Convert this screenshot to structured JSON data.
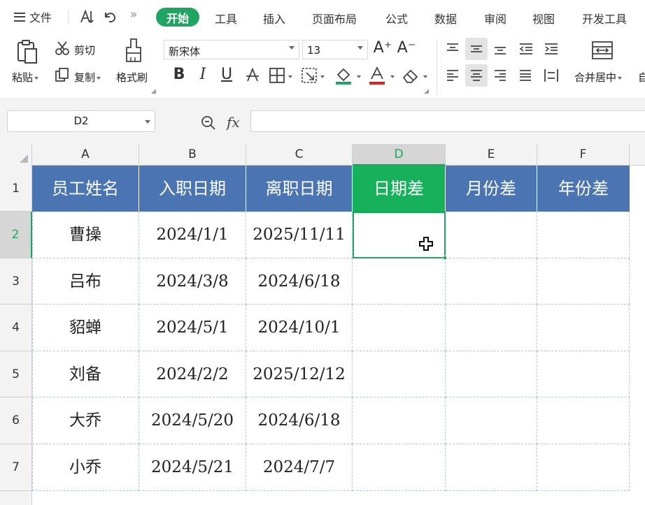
{
  "menubar": {
    "file_label": "文件",
    "tabs": [
      "开始",
      "工具",
      "插入",
      "页面布局",
      "公式",
      "数据",
      "审阅",
      "视图",
      "开发工具"
    ],
    "active_tab": "开始"
  },
  "ribbon": {
    "paste_label": "粘贴",
    "cut_label": "剪切",
    "copy_label": "复制",
    "format_painter_label": "格式刷",
    "font_name": "新宋体",
    "font_size": "13",
    "merge_label": "合并居中",
    "bold": "B",
    "italic": "I",
    "underline": "U",
    "font_grow": "A⁺",
    "font_shrink": "A⁻"
  },
  "formula_bar": {
    "cell_ref": "D2",
    "fx_label": "fx",
    "formula": ""
  },
  "sheet": {
    "columns": [
      "A",
      "B",
      "C",
      "D",
      "E",
      "F"
    ],
    "selected_column": "D",
    "rows": [
      "1",
      "2",
      "3",
      "4",
      "5",
      "6",
      "7"
    ],
    "selected_row": "2",
    "headers": [
      "员工姓名",
      "入职日期",
      "离职日期",
      "日期差",
      "月份差",
      "年份差"
    ],
    "data": [
      [
        "曹操",
        "2024/1/1",
        "2025/11/11",
        "",
        "",
        ""
      ],
      [
        "吕布",
        "2024/3/8",
        "2024/6/18",
        "",
        "",
        ""
      ],
      [
        "貂蝉",
        "2024/5/1",
        "2024/10/1",
        "",
        "",
        ""
      ],
      [
        "刘备",
        "2024/2/2",
        "2025/12/12",
        "",
        "",
        ""
      ],
      [
        "大乔",
        "2024/5/20",
        "2024/6/18",
        "",
        "",
        ""
      ],
      [
        "小乔",
        "2024/5/21",
        "2024/7/7",
        "",
        "",
        ""
      ]
    ]
  },
  "colors": {
    "accent_green": "#1fa462",
    "header_blue": "#4a74b2",
    "header_selected_green": "#17b15c"
  }
}
